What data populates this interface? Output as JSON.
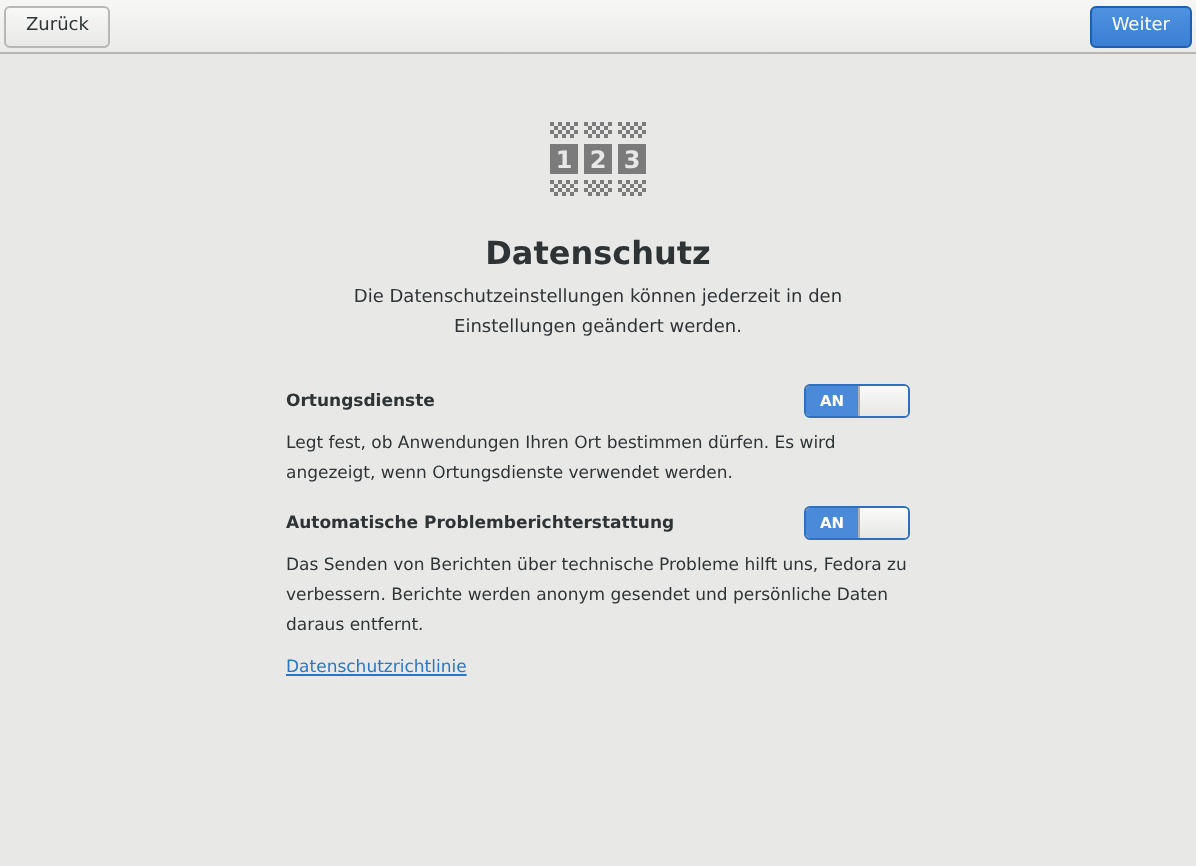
{
  "header": {
    "back_button": "Zurück",
    "next_button": "Weiter"
  },
  "icon_digits": [
    "1",
    "2",
    "3"
  ],
  "title": "Datenschutz",
  "subtitle": "Die Datenschutzeinstellungen können jederzeit in den Einstellungen geändert werden.",
  "settings": [
    {
      "label": "Ortungsdienste",
      "switch_text": "AN",
      "on": true,
      "description": "Legt fest, ob Anwendungen Ihren Ort bestimmen dürfen. Es wird angezeigt, wenn Ortungsdienste verwendet werden."
    },
    {
      "label": "Automatische Problemberichterstattung",
      "switch_text": "AN",
      "on": true,
      "description": "Das Senden von Berichten über technische Probleme hilft uns, Fedora zu verbessern. Berichte werden anonym gesendet und persönliche Daten daraus entfernt."
    }
  ],
  "link": "Datenschutzrichtlinie"
}
